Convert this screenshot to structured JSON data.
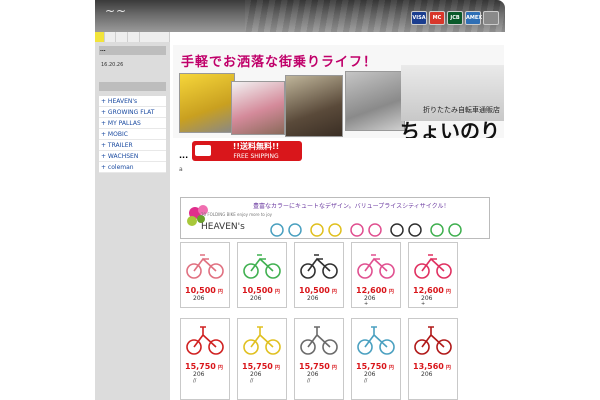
{
  "header": {
    "title": "~~",
    "cards": [
      {
        "name": "VISA",
        "color": "#1a3d8f"
      },
      {
        "name": "MC",
        "color": "#d8362a"
      },
      {
        "name": "JCB",
        "color": "#0a5a2a"
      },
      {
        "name": "AMEX",
        "color": "#2f6fb5"
      },
      {
        "name": "",
        "color": "#8a8a8a"
      }
    ]
  },
  "sidebar": {
    "head1": "...",
    "date": "16.20.26",
    "head2": "",
    "menu": [
      "+ HEAVEN's",
      "+ GROWING FLAT",
      "+ MY PALLAS",
      "+ MOBIC",
      "+ TRAILER",
      "+ WACHSEN",
      "+ coleman"
    ]
  },
  "main": {
    "banner_title": "手軽でお洒落な街乗りライフ！",
    "brand_sub": "折りたたみ自転車通販店",
    "brand_main": "ちょいのり",
    "shipping_line1": "!!送料無料!!",
    "shipping_line2": "FREE SHIPPING",
    "dots": "...",
    "tiny": "a",
    "heaven_tagline": "豊富なカラーにキュートなデザイン。バリュープライスシティサイクル！",
    "heaven_name": "HEAVEN's",
    "heaven_sub": "20 FOLDING BIKE\nenjoy more to joy"
  },
  "products": [
    {
      "price": "10,500",
      "yen": "円",
      "code": "206",
      "extra": "",
      "color": "#e07080"
    },
    {
      "price": "10,500",
      "yen": "円",
      "code": "206",
      "extra": "",
      "color": "#40b050"
    },
    {
      "price": "10,500",
      "yen": "円",
      "code": "206",
      "extra": "",
      "color": "#303030"
    },
    {
      "price": "12,600",
      "yen": "円",
      "code": "206",
      "extra": "+",
      "color": "#e05090"
    },
    {
      "price": "12,600",
      "yen": "円",
      "code": "206",
      "extra": "+",
      "color": "#e03060"
    },
    {
      "price": "15,750",
      "yen": "円",
      "code": "206",
      "extra": "//",
      "color": "#d02020"
    },
    {
      "price": "15,750",
      "yen": "円",
      "code": "206",
      "extra": "//",
      "color": "#e0c020"
    },
    {
      "price": "15,750",
      "yen": "円",
      "code": "206",
      "extra": "//",
      "color": "#6a6a6a"
    },
    {
      "price": "15,750",
      "yen": "円",
      "code": "206",
      "extra": "//",
      "color": "#4aa0c0"
    },
    {
      "price": "13,560",
      "yen": "円",
      "code": "206",
      "extra": "",
      "color": "#b01818"
    }
  ]
}
